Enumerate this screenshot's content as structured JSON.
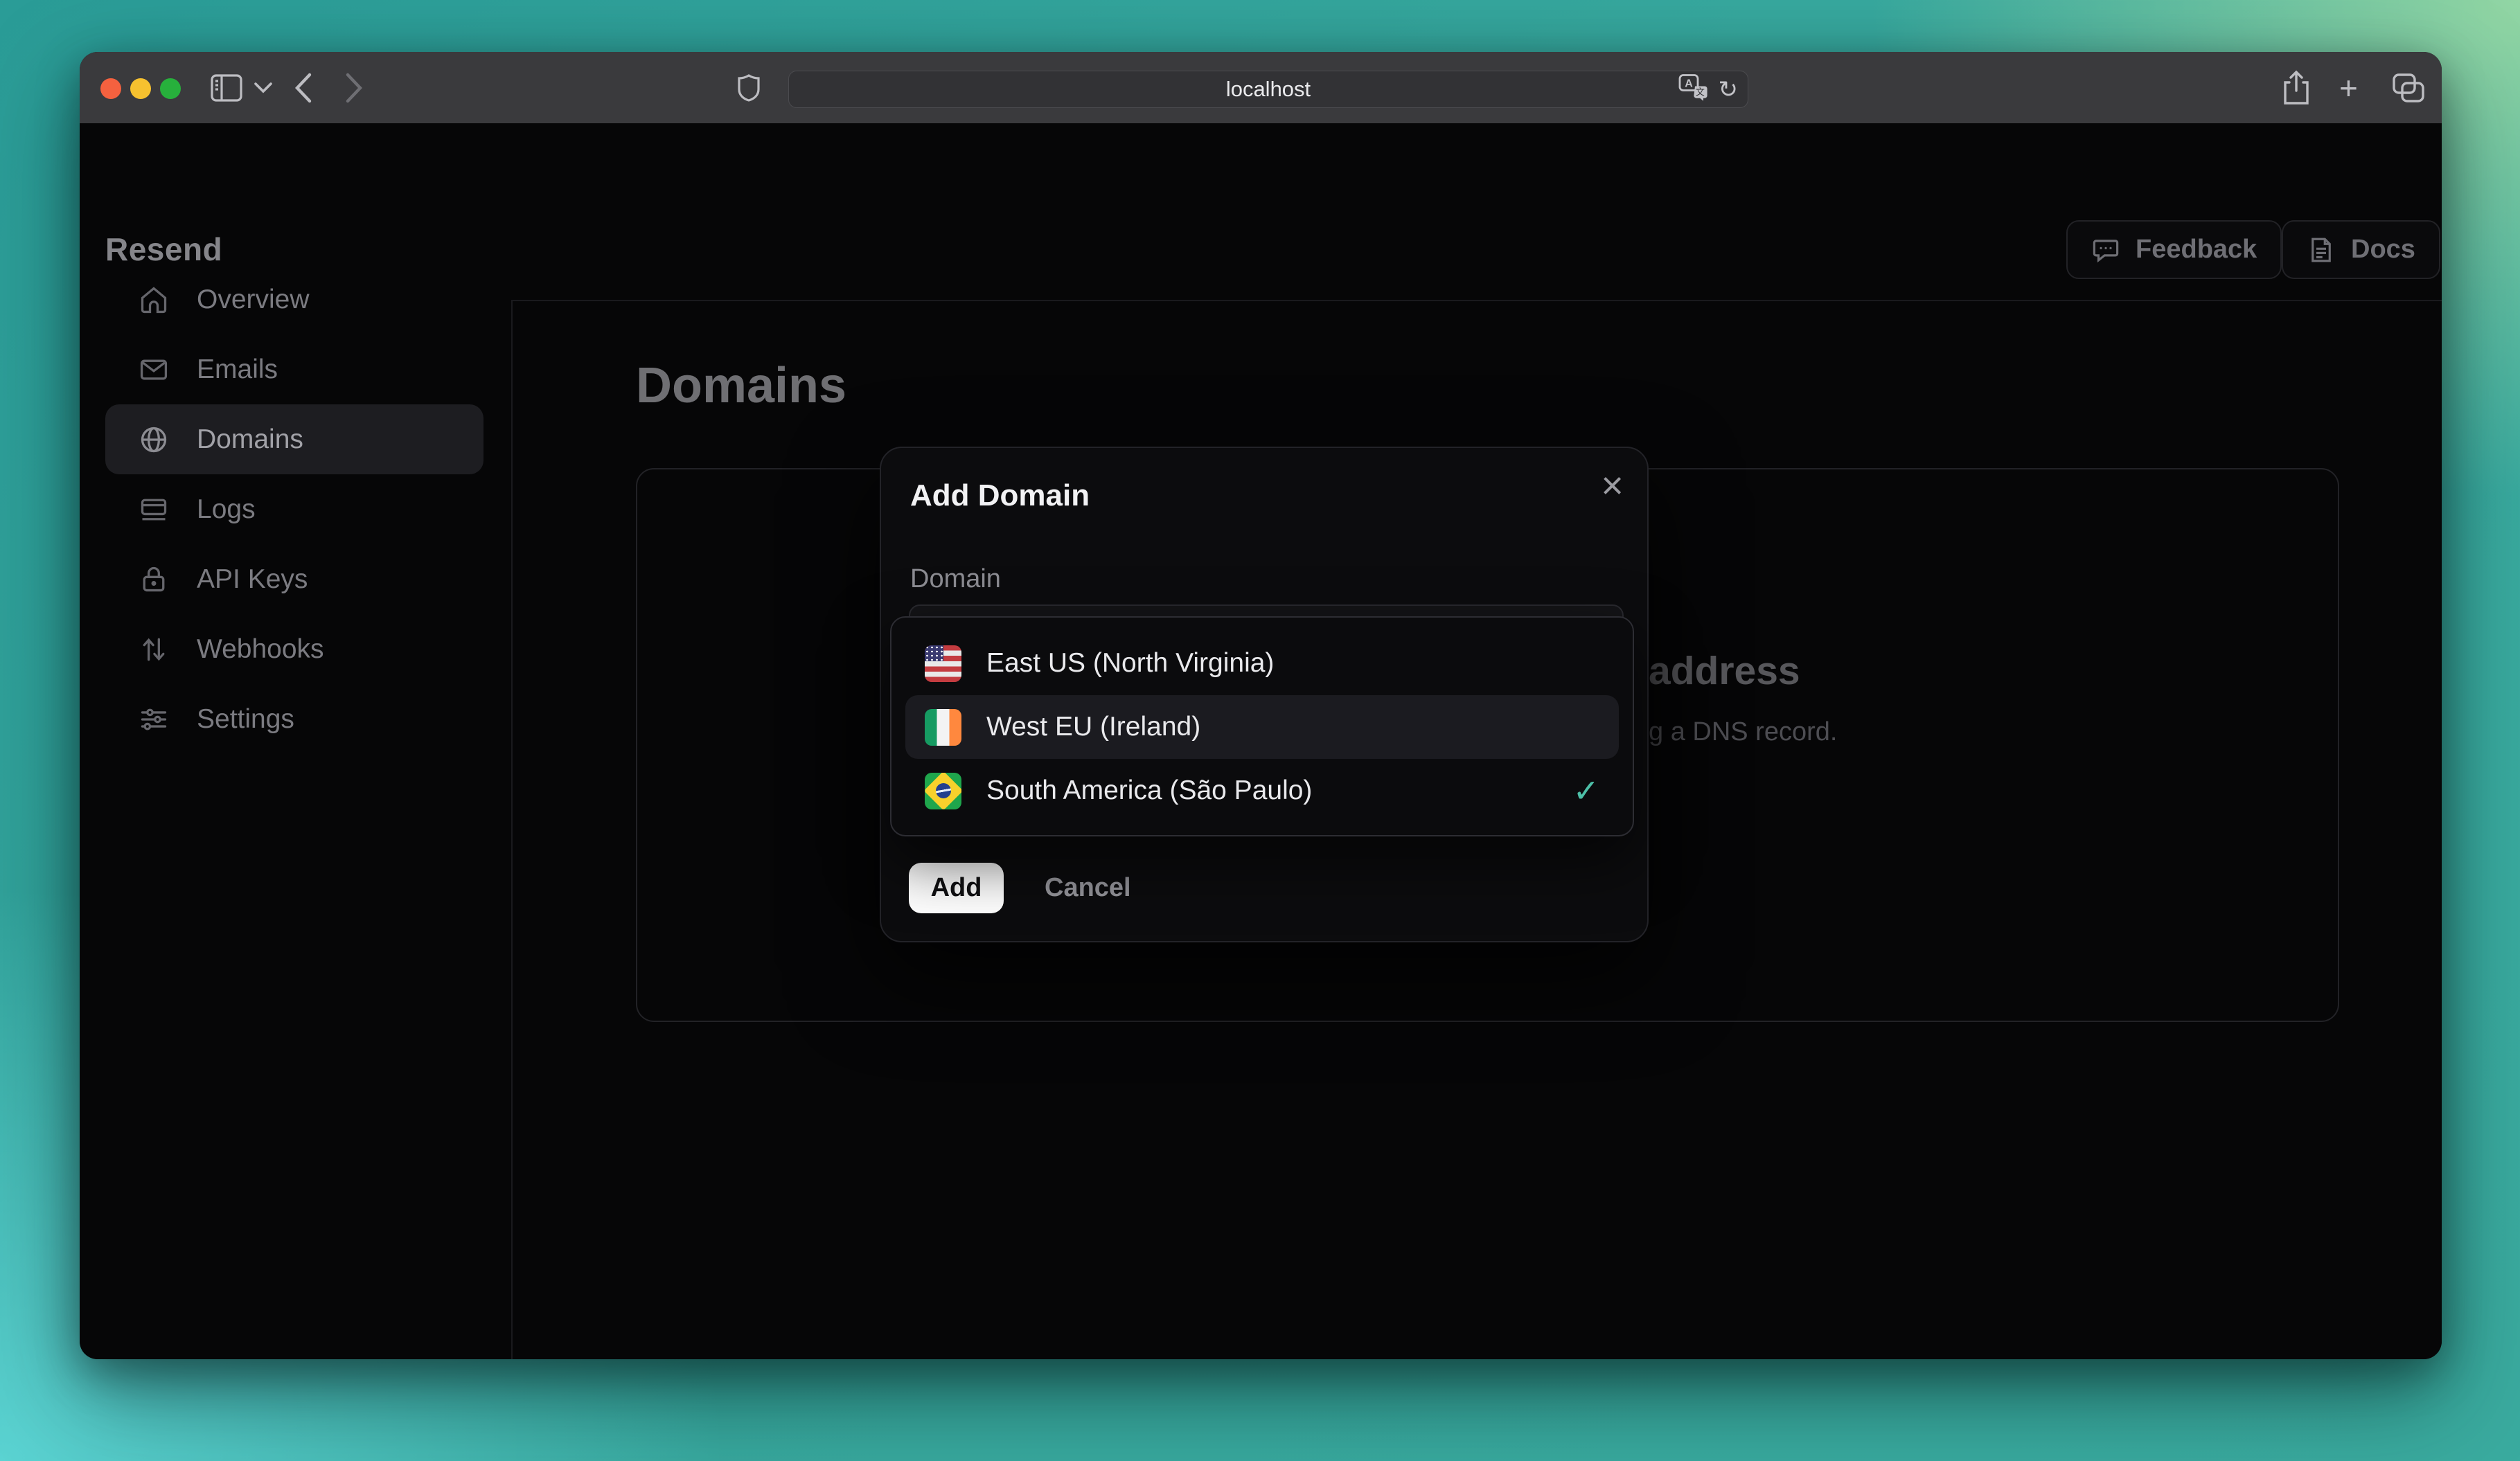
{
  "browser": {
    "address": "localhost",
    "toolbar_icons": [
      "sidebar-toggle-icon",
      "chevron-down-icon",
      "back-icon",
      "forward-icon",
      "shield-icon",
      "translate-icon",
      "reload-icon",
      "share-icon",
      "new-tab-icon",
      "tab-overview-icon"
    ],
    "traffic_lights": [
      "close",
      "minimize",
      "zoom"
    ]
  },
  "sidebar": {
    "logo": "Resend",
    "items": [
      {
        "label": "Overview",
        "icon": "home-icon",
        "active": false
      },
      {
        "label": "Emails",
        "icon": "mail-icon",
        "active": false
      },
      {
        "label": "Domains",
        "icon": "globe-icon",
        "active": true
      },
      {
        "label": "Logs",
        "icon": "logs-icon",
        "active": false
      },
      {
        "label": "API Keys",
        "icon": "lock-icon",
        "active": false
      },
      {
        "label": "Webhooks",
        "icon": "arrows-up-down-icon",
        "active": false
      },
      {
        "label": "Settings",
        "icon": "sliders-icon",
        "active": false
      }
    ]
  },
  "header": {
    "feedback_label": "Feedback",
    "feedback_icon": "chat-bubble-icon",
    "docs_label": "Docs",
    "docs_icon": "document-icon"
  },
  "page": {
    "title": "Domains",
    "card_heading_fragment": "address",
    "card_text_fragment": "g a DNS record."
  },
  "modal": {
    "title": "Add Domain",
    "close_icon": "close-icon",
    "field_label": "Domain",
    "input_value": "",
    "regions": [
      {
        "label": "East US (North Virginia)",
        "flag": "us-flag",
        "highlighted": false,
        "selected": false
      },
      {
        "label": "West EU (Ireland)",
        "flag": "ireland-flag",
        "highlighted": true,
        "selected": false
      },
      {
        "label": "South America (São Paulo)",
        "flag": "brazil-flag",
        "highlighted": false,
        "selected": true
      }
    ],
    "add_label": "Add",
    "cancel_label": "Cancel"
  },
  "colors": {
    "accent_check": "#4dbfa7",
    "traffic_red": "#f4613f",
    "traffic_yellow": "#f6c12f",
    "traffic_green": "#27b03c",
    "desktop_teal": "#2a9c97",
    "desktop_cyan": "#5fd8d8",
    "desktop_green": "#97d8a4",
    "add_button_bg": "#ffffff"
  }
}
